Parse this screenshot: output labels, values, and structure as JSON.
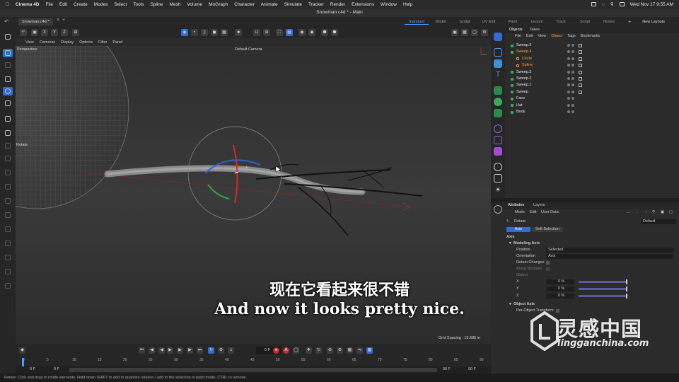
{
  "menubar": {
    "app": "Cinema 4D",
    "items": [
      "File",
      "Edit",
      "Create",
      "Modes",
      "Select",
      "Tools",
      "Spline",
      "Mesh",
      "Volume",
      "MoGraph",
      "Character",
      "Animate",
      "Simulate",
      "Tracker",
      "Render",
      "Extensions",
      "Window",
      "Help"
    ],
    "clock": "Wed Nov 17  9:55 AM"
  },
  "window": {
    "title": "Snowman.c4d * - Main"
  },
  "tabs": {
    "document": "Snowman.c4d *",
    "layouts": [
      "Standard",
      "Model",
      "Sculpt",
      "UV Edit",
      "Paint",
      "Groom",
      "Track",
      "Script",
      "Nodes"
    ],
    "active_layout": "Standard",
    "new_layouts": "New Layouts"
  },
  "toolbar": {
    "axis_labels": [
      "X",
      "Y",
      "Z"
    ]
  },
  "viewport": {
    "menu": [
      "View",
      "Cameras",
      "Display",
      "Options",
      "Filter",
      "Panel"
    ],
    "projection": "Perspective",
    "camera": "Default Camera",
    "tool_label": "Rotate",
    "grid_spacing": "Grid Spacing : 19.685 in"
  },
  "subtitles": {
    "zh": "现在它看起来很不错",
    "en": "And now it looks pretty nice."
  },
  "objects": {
    "tabs": [
      "Objects",
      "Takes"
    ],
    "menu": [
      "File",
      "Edit",
      "View",
      "Object",
      "Tags",
      "Bookmarks"
    ],
    "active_menu": "Object",
    "rows": [
      {
        "name": "Sweep.5",
        "indent": 0,
        "color": "#e6e6e6"
      },
      {
        "name": "Sweep.4",
        "indent": 0,
        "color": "#ff9f2a"
      },
      {
        "name": "Circle",
        "indent": 1,
        "color": "#ff9f2a"
      },
      {
        "name": "Spline",
        "indent": 1,
        "color": "#ff9f2a"
      },
      {
        "name": "Sweep.3",
        "indent": 0,
        "color": "#e6e6e6"
      },
      {
        "name": "Sweep.2",
        "indent": 0,
        "color": "#e6e6e6"
      },
      {
        "name": "Sweep.1",
        "indent": 0,
        "color": "#e6e6e6"
      },
      {
        "name": "Sweep",
        "indent": 0,
        "color": "#e6e6e6"
      },
      {
        "name": "Face",
        "indent": 0,
        "color": "#e6e6e6"
      },
      {
        "name": "Hat",
        "indent": 0,
        "color": "#e6e6e6"
      },
      {
        "name": "Body",
        "indent": 0,
        "color": "#e6e6e6"
      }
    ]
  },
  "attributes": {
    "tabs": [
      "Attributes",
      "Layers"
    ],
    "menu": [
      "Mode",
      "Edit",
      "User Data"
    ],
    "tool": "Rotate",
    "preset": "Default",
    "subtabs": [
      "Axis",
      "Soft Selection"
    ],
    "section": "Axis",
    "group_modeling": "Modeling Axis",
    "position_label": "Position",
    "position_value": "Selected",
    "orientation_label": "Orientation",
    "orientation_value": "Axis",
    "retain_changes": "Retain Changes",
    "along_normals": "Along Normals",
    "object_label": "Object",
    "x_label": "X",
    "x_value": "0 %",
    "y_label": "Y",
    "y_value": "0 %",
    "z_label": "Z",
    "z_value": "0 %",
    "group_object": "Object Axis",
    "per_object": "Per-Object Transform"
  },
  "timeline": {
    "current_frame": "0 F",
    "ticks": [
      "0",
      "5",
      "10",
      "15",
      "20",
      "25",
      "30",
      "35",
      "40",
      "45",
      "50",
      "55",
      "60",
      "65",
      "70",
      "75",
      "80",
      "85",
      "90"
    ],
    "start": "0 F",
    "start2": "0 F",
    "end": "90 F",
    "end2": "90 F"
  },
  "status": "Rotate: Click and drag to rotate elements. Hold down SHIFT to add to quantize rotation / add to the selection in point mode, CTRL to remove.",
  "watermark": {
    "cn": "灵感中国",
    "en": "lingganchina.com"
  }
}
